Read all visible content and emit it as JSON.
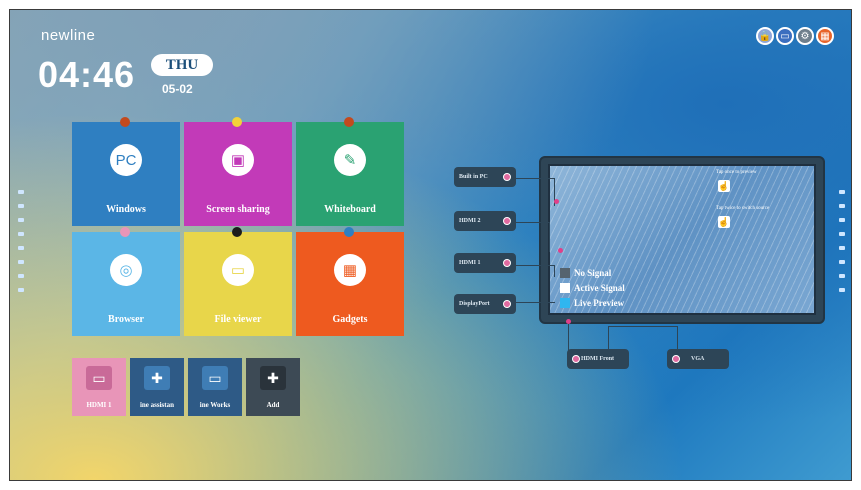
{
  "brand": "newline",
  "clock": {
    "time": "04:46",
    "day": "THU",
    "date": "05-02"
  },
  "top_icons": [
    {
      "name": "lock-icon",
      "glyph": "🔒",
      "color": "#8fa6d8"
    },
    {
      "name": "monitor-icon",
      "glyph": "▭",
      "color": "#3c6fbf"
    },
    {
      "name": "gear-icon",
      "glyph": "⚙",
      "color": "#6f7f8c"
    },
    {
      "name": "signal-source-icon",
      "glyph": "▦",
      "color": "#e8642a"
    }
  ],
  "tiles": [
    {
      "label": "Windows",
      "icon": "PC",
      "color": "#2f7fc1"
    },
    {
      "label": "Screen sharing",
      "icon": "▣",
      "color": "#c23ab8"
    },
    {
      "label": "Whiteboard",
      "icon": "✎",
      "color": "#2aa272"
    },
    {
      "label": "Browser",
      "icon": "◎",
      "color": "#5bb6e6"
    },
    {
      "label": "File viewer",
      "icon": "▭",
      "color": "#e8d64a"
    },
    {
      "label": "Gadgets",
      "icon": "▦",
      "color": "#ee5a1f"
    }
  ],
  "small_tiles": [
    {
      "label": "HDMI 1",
      "icon": "▭",
      "color": "#e895b8"
    },
    {
      "label": "ine assistan",
      "icon": "✚",
      "color": "#2e5a86"
    },
    {
      "label": "ine Works",
      "icon": "▭",
      "color": "#2e5a86"
    },
    {
      "label": "Add",
      "icon": "✚",
      "color": "#3d4a55"
    }
  ],
  "ports": {
    "built_in_pc": "Built in PC",
    "hdmi2": "HDMI 2",
    "hdmi1": "HDMI 1",
    "displayport": "DisplayPort",
    "hdmi_front": "HDMI Front",
    "vga": "VGA"
  },
  "legend": [
    {
      "label": "No Signal",
      "color": "#55636e"
    },
    {
      "label": "Active Signal",
      "color": "#ffffff"
    },
    {
      "label": "Live Preview",
      "color": "#2fb6f0"
    }
  ],
  "hints": {
    "preview": "Tap once to preview",
    "switch": "Tap twice to switch source"
  }
}
